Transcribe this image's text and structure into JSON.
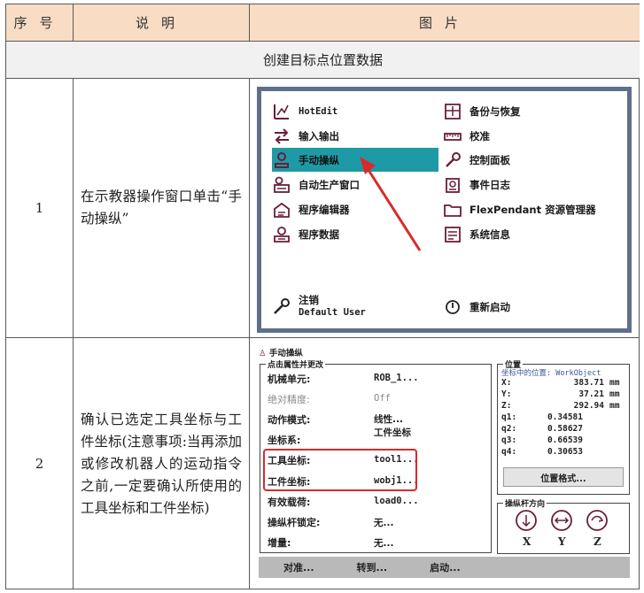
{
  "header": {
    "col_num": "序号",
    "col_desc": "说明",
    "col_img": "图片"
  },
  "section_title": "创建目标点位置数据",
  "rows": [
    {
      "num": "1",
      "desc": "在示教器操作窗口单击“手动操纵”"
    },
    {
      "num": "2",
      "desc": "确认已选定工具坐标与工件坐标(注意事项:当再添加或修改机器人的运动指令之前,一定要确认所使用的工具坐标和工件坐标)"
    }
  ],
  "menu": {
    "left": [
      "HotEdit",
      "输入输出",
      "手动操纵",
      "自动生产窗口",
      "程序编辑器",
      "程序数据"
    ],
    "right": [
      "备份与恢复",
      "校准",
      "控制面板",
      "事件日志",
      "FlexPendant 资源管理器",
      "系统信息"
    ],
    "logout_label": "注销",
    "logout_user": "Default User",
    "restart": "重新启动",
    "highlight_color": "#1e9aa6",
    "arrow_color": "#d72b2b"
  },
  "jog": {
    "title": "手动操纵",
    "props_group": "点击属性并更改",
    "props": [
      {
        "label": "机械单元:",
        "value": "ROB_1..."
      },
      {
        "label": "绝对精度:",
        "value": "Off"
      },
      {
        "label": "动作模式:",
        "value": "线性..."
      },
      {
        "label": "坐标系:",
        "value": "工件坐标"
      },
      {
        "label": "工具坐标:",
        "value": "tool1..."
      },
      {
        "label": "工件坐标:",
        "value": "wobj1..."
      },
      {
        "label": "有效载荷:",
        "value": "load0..."
      },
      {
        "label": "操纵杆锁定:",
        "value": "无..."
      },
      {
        "label": "增量:",
        "value": "无..."
      }
    ],
    "pos_group": "位置",
    "pos_frame": "坐标中的位置: WorkObject",
    "positions": [
      {
        "name": "X:",
        "value": "383.71",
        "unit": "mm"
      },
      {
        "name": "Y:",
        "value": "37.21",
        "unit": "mm"
      },
      {
        "name": "Z:",
        "value": "292.94",
        "unit": "mm"
      },
      {
        "name": "q1:",
        "value": "0.34581",
        "unit": ""
      },
      {
        "name": "q2:",
        "value": "0.58627",
        "unit": ""
      },
      {
        "name": "q3:",
        "value": "0.66539",
        "unit": ""
      },
      {
        "name": "q4:",
        "value": "0.30653",
        "unit": ""
      }
    ],
    "pos_format_button": "位置格式...",
    "joystick_group": "操纵杆方向",
    "axes": [
      "X",
      "Y",
      "Z"
    ],
    "buttons": [
      "对准...",
      "转到...",
      "启动..."
    ]
  }
}
